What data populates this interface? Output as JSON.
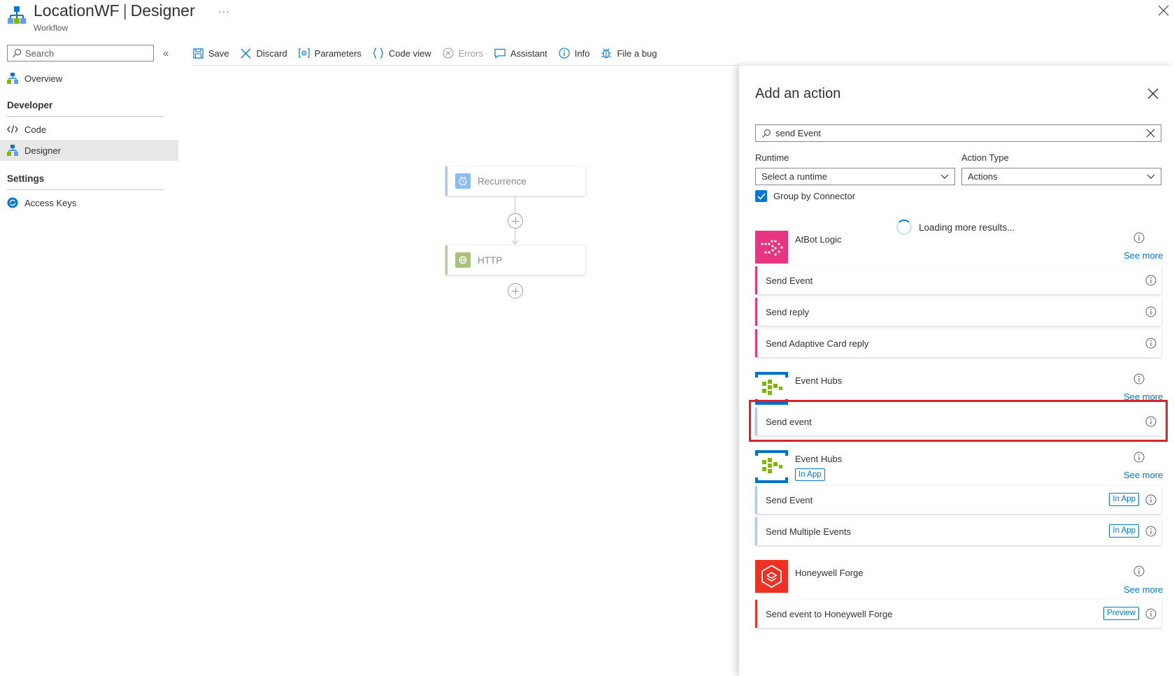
{
  "header": {
    "title": "LocationWF",
    "separator": "|",
    "title_suffix": "Designer",
    "subtitle": "Workflow",
    "more_label": "···"
  },
  "nav": {
    "search_placeholder": "Search",
    "collapse_label": "«",
    "overview": "Overview",
    "developer_section": "Developer",
    "code": "Code",
    "designer": "Designer",
    "settings_section": "Settings",
    "access_keys": "Access Keys"
  },
  "toolbar": {
    "save": "Save",
    "discard": "Discard",
    "parameters": "Parameters",
    "code_view": "Code view",
    "errors": "Errors",
    "assistant": "Assistant",
    "info": "Info",
    "file_bug": "File a bug"
  },
  "canvas": {
    "steps": [
      {
        "label": "Recurrence",
        "color": "#1f85ff"
      },
      {
        "label": "HTTP",
        "color": "#709727"
      }
    ]
  },
  "panel": {
    "title": "Add an action",
    "search_value": "send Event",
    "runtime_label": "Runtime",
    "runtime_value": "Select a runtime",
    "action_type_label": "Action Type",
    "action_type_value": "Actions",
    "group_by_connector": "Group by Connector",
    "group_by_connector_checked": true,
    "loading": "Loading more results...",
    "see_more": "See more",
    "connectors": [
      {
        "name": "AtBot Logic",
        "color": "#e8357f",
        "actions": [
          {
            "label": "Send Event"
          },
          {
            "label": "Send reply"
          },
          {
            "label": "Send Adaptive Card reply"
          }
        ]
      },
      {
        "name": "Event Hubs",
        "color": "#0072c6",
        "actions": [
          {
            "label": "Send event",
            "highlighted": true
          }
        ]
      },
      {
        "name": "Event Hubs",
        "tag": "In App",
        "color": "#0072c6",
        "actions": [
          {
            "label": "Send Event",
            "tag": "In App"
          },
          {
            "label": "Send Multiple Events",
            "tag": "In App"
          }
        ]
      },
      {
        "name": "Honeywell Forge",
        "color": "#ee3124",
        "actions": [
          {
            "label": "Send event to Honeywell Forge",
            "tag": "Preview"
          }
        ]
      }
    ]
  }
}
